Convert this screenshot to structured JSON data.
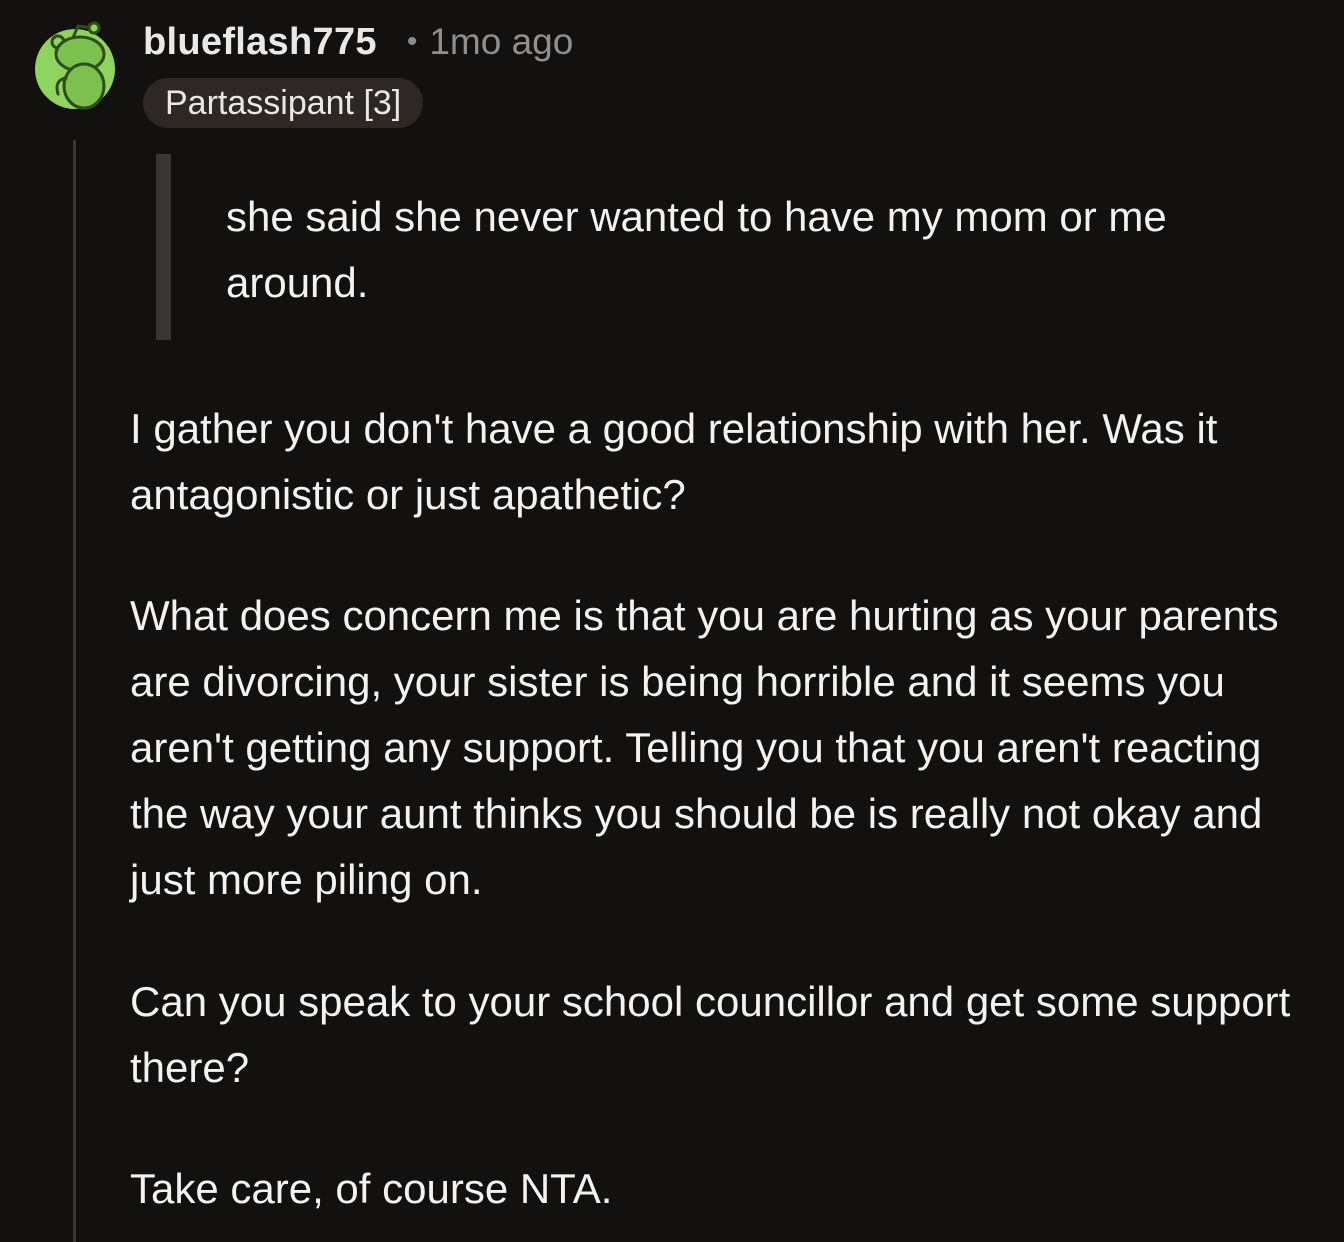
{
  "comment": {
    "author": "blueflash775",
    "separator": "•",
    "timestamp": "1mo ago",
    "flair": "Partassipant [3]",
    "avatar_icon": "snoo-avatar-icon",
    "quote": "she said she never wanted to have my mom or me around.",
    "paragraphs": [
      "I gather you don't have a good relationship with her. Was it antagonistic or just apathetic?",
      "What does concern me is that you are hurting as your parents are divorcing, your sister is being horrible and it seems you aren't getting any support. Telling you that you aren't reacting the way your aunt thinks you should be is really not okay and just more piling on.",
      "Can you speak to your school councillor and get some support there?",
      "Take care, of course NTA."
    ]
  },
  "colors": {
    "background": "#13110f",
    "text": "#f2f2f2",
    "muted": "#8f8f8f",
    "flair_bg": "#2e2824",
    "avatar_green": "#8fd45e",
    "thread_line": "#3a3733"
  }
}
